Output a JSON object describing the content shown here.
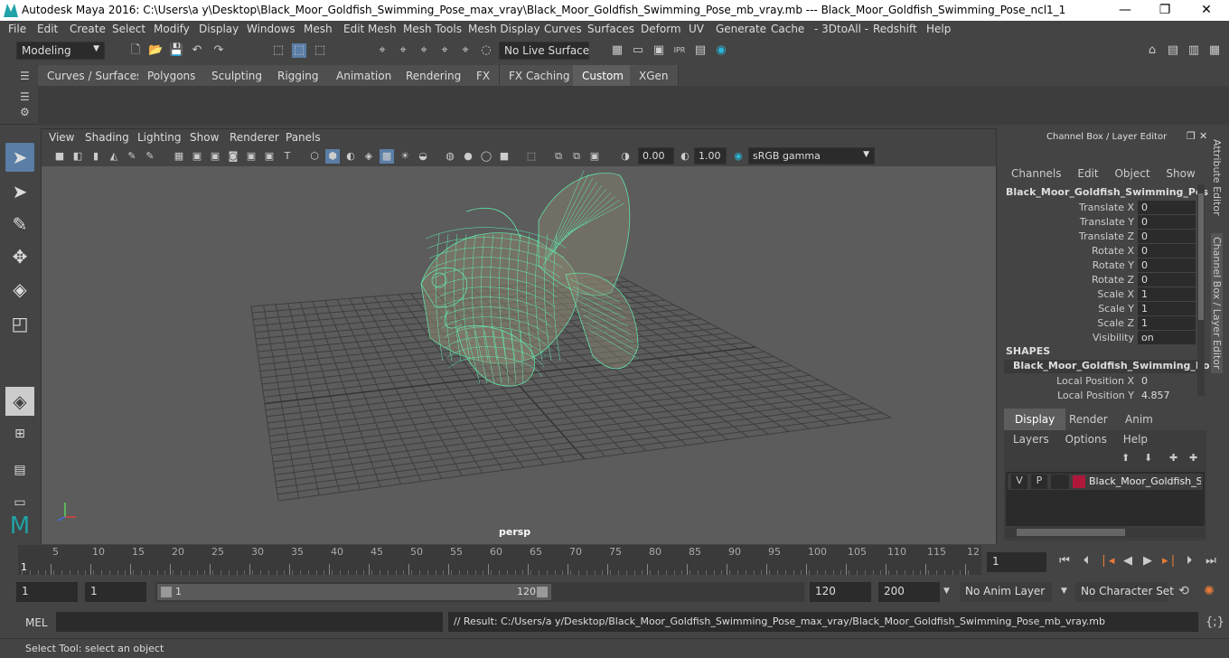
{
  "window": {
    "title": "Autodesk Maya 2016: C:\\Users\\a y\\Desktop\\Black_Moor_Goldfish_Swimming_Pose_max_vray\\Black_Moor_Goldfish_Swimming_Pose_mb_vray.mb   ---   Black_Moor_Goldfish_Swimming_Pose_ncl1_1"
  },
  "menu": [
    "File",
    "Edit",
    "Create",
    "Select",
    "Modify",
    "Display",
    "Windows",
    "Mesh",
    "Edit Mesh",
    "Mesh Tools",
    "Mesh Display",
    "Curves",
    "Surfaces",
    "Deform",
    "UV",
    "Generate",
    "Cache",
    "- 3DtoAll -",
    "Redshift",
    "Help"
  ],
  "toolbar": {
    "mode": "Modeling",
    "live_surface": "No Live Surface"
  },
  "shelf_tabs": [
    "Curves / Surfaces",
    "Polygons",
    "Sculpting",
    "Rigging",
    "Animation",
    "Rendering",
    "FX",
    "FX Caching",
    "Custom",
    "XGen"
  ],
  "shelf_active": "Custom",
  "viewport": {
    "menus": [
      "View",
      "Shading",
      "Lighting",
      "Show",
      "Renderer",
      "Panels"
    ],
    "exposure": "0.00",
    "gamma": "1.00",
    "color_space": "sRGB gamma",
    "camera": "persp"
  },
  "channel_box": {
    "header": "Channel Box / Layer Editor",
    "menus": [
      "Channels",
      "Edit",
      "Object",
      "Show"
    ],
    "object": "Black_Moor_Goldfish_Swimming_Pos...",
    "attributes": [
      {
        "label": "Translate X",
        "value": "0"
      },
      {
        "label": "Translate Y",
        "value": "0"
      },
      {
        "label": "Translate Z",
        "value": "0"
      },
      {
        "label": "Rotate X",
        "value": "0"
      },
      {
        "label": "Rotate Y",
        "value": "0"
      },
      {
        "label": "Rotate Z",
        "value": "0"
      },
      {
        "label": "Scale X",
        "value": "1"
      },
      {
        "label": "Scale Y",
        "value": "1"
      },
      {
        "label": "Scale Z",
        "value": "1"
      },
      {
        "label": "Visibility",
        "value": "on"
      }
    ],
    "shapes_label": "SHAPES",
    "shape_name": "Black_Moor_Goldfish_Swimming_Po...",
    "shape_attrs": [
      {
        "label": "Local Position X",
        "value": "0"
      },
      {
        "label": "Local Position Y",
        "value": "4.857"
      }
    ]
  },
  "layer_editor": {
    "tabs": [
      "Display",
      "Render",
      "Anim"
    ],
    "active_tab": "Display",
    "menus": [
      "Layers",
      "Options",
      "Help"
    ],
    "layer": {
      "v": "V",
      "p": "P",
      "name": "Black_Moor_Goldfish_Sw",
      "color": "#b0183a"
    }
  },
  "side_tabs": [
    "Attribute Editor",
    "Channel Box / Layer Editor"
  ],
  "timeline": {
    "ticks": [
      "5",
      "10",
      "15",
      "20",
      "25",
      "30",
      "35",
      "40",
      "45",
      "50",
      "55",
      "60",
      "65",
      "70",
      "75",
      "80",
      "85",
      "90",
      "95",
      "100",
      "105",
      "110",
      "115",
      "12"
    ],
    "start_marker": "1",
    "current_frame": "1"
  },
  "range": {
    "start": "1",
    "playback_start": "1",
    "slider_start": "1",
    "slider_end": "120",
    "playback_end": "120",
    "end": "200",
    "anim_layer": "No Anim Layer",
    "character_set": "No Character Set"
  },
  "command": {
    "lang": "MEL",
    "result": "// Result: C:/Users/a y/Desktop/Black_Moor_Goldfish_Swimming_Pose_max_vray/Black_Moor_Goldfish_Swimming_Pose_mb_vray.mb"
  },
  "help_line": "Select Tool: select an object",
  "colors": {
    "accent": "#1fa3a8",
    "wire": "#5ff0b0",
    "layer": "#b0183a"
  }
}
